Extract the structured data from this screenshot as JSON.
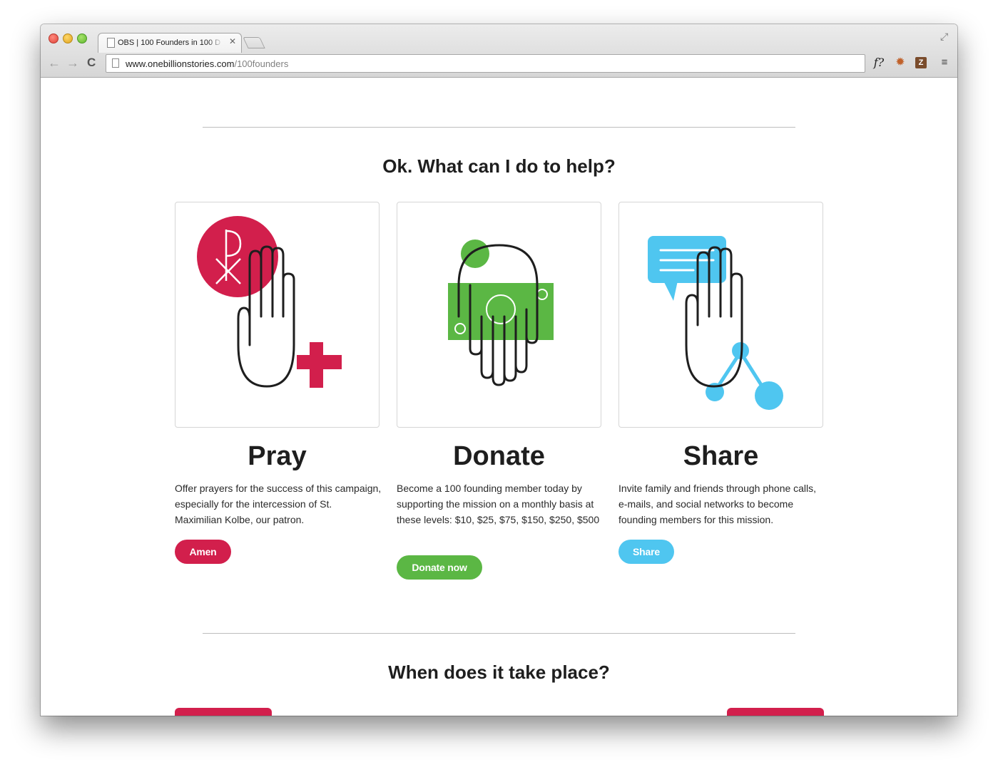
{
  "browser": {
    "tab_title": "OBS | 100 Founders in 100 D",
    "close_glyph": "✕",
    "url_domain": "www.onebillionstories.com",
    "url_path": "/100founders",
    "back_glyph": "←",
    "forward_glyph": "→",
    "reload_glyph": "C",
    "fullscreen_glyph": "⤢",
    "ext_f": "f?",
    "ext_bug": "✹",
    "ext_z": "Z",
    "menu_glyph": "≡"
  },
  "section1": {
    "title": "Ok. What can I do to help?"
  },
  "actions": [
    {
      "title": "Pray",
      "description": "Offer prayers for the success of this campaign, especially for the intercession of St. Maximilian Kolbe, our patron.",
      "button": "Amen",
      "color": "#d21f4c",
      "icon": "praying-hand-icon"
    },
    {
      "title": "Donate",
      "description": "Become a 100 founding member today by supporting the mission on a monthly basis at these levels: $10, $25, $75, $150, $250, $500",
      "button": "Donate now",
      "color": "#5bb744",
      "icon": "donate-hand-icon"
    },
    {
      "title": "Share",
      "description": "Invite family and friends through phone calls, e-mails, and social networks to become founding members for this mission.",
      "button": "Share",
      "color": "#4fc6f0",
      "icon": "share-hand-icon"
    }
  ],
  "section2": {
    "title": "When does it take place?"
  }
}
